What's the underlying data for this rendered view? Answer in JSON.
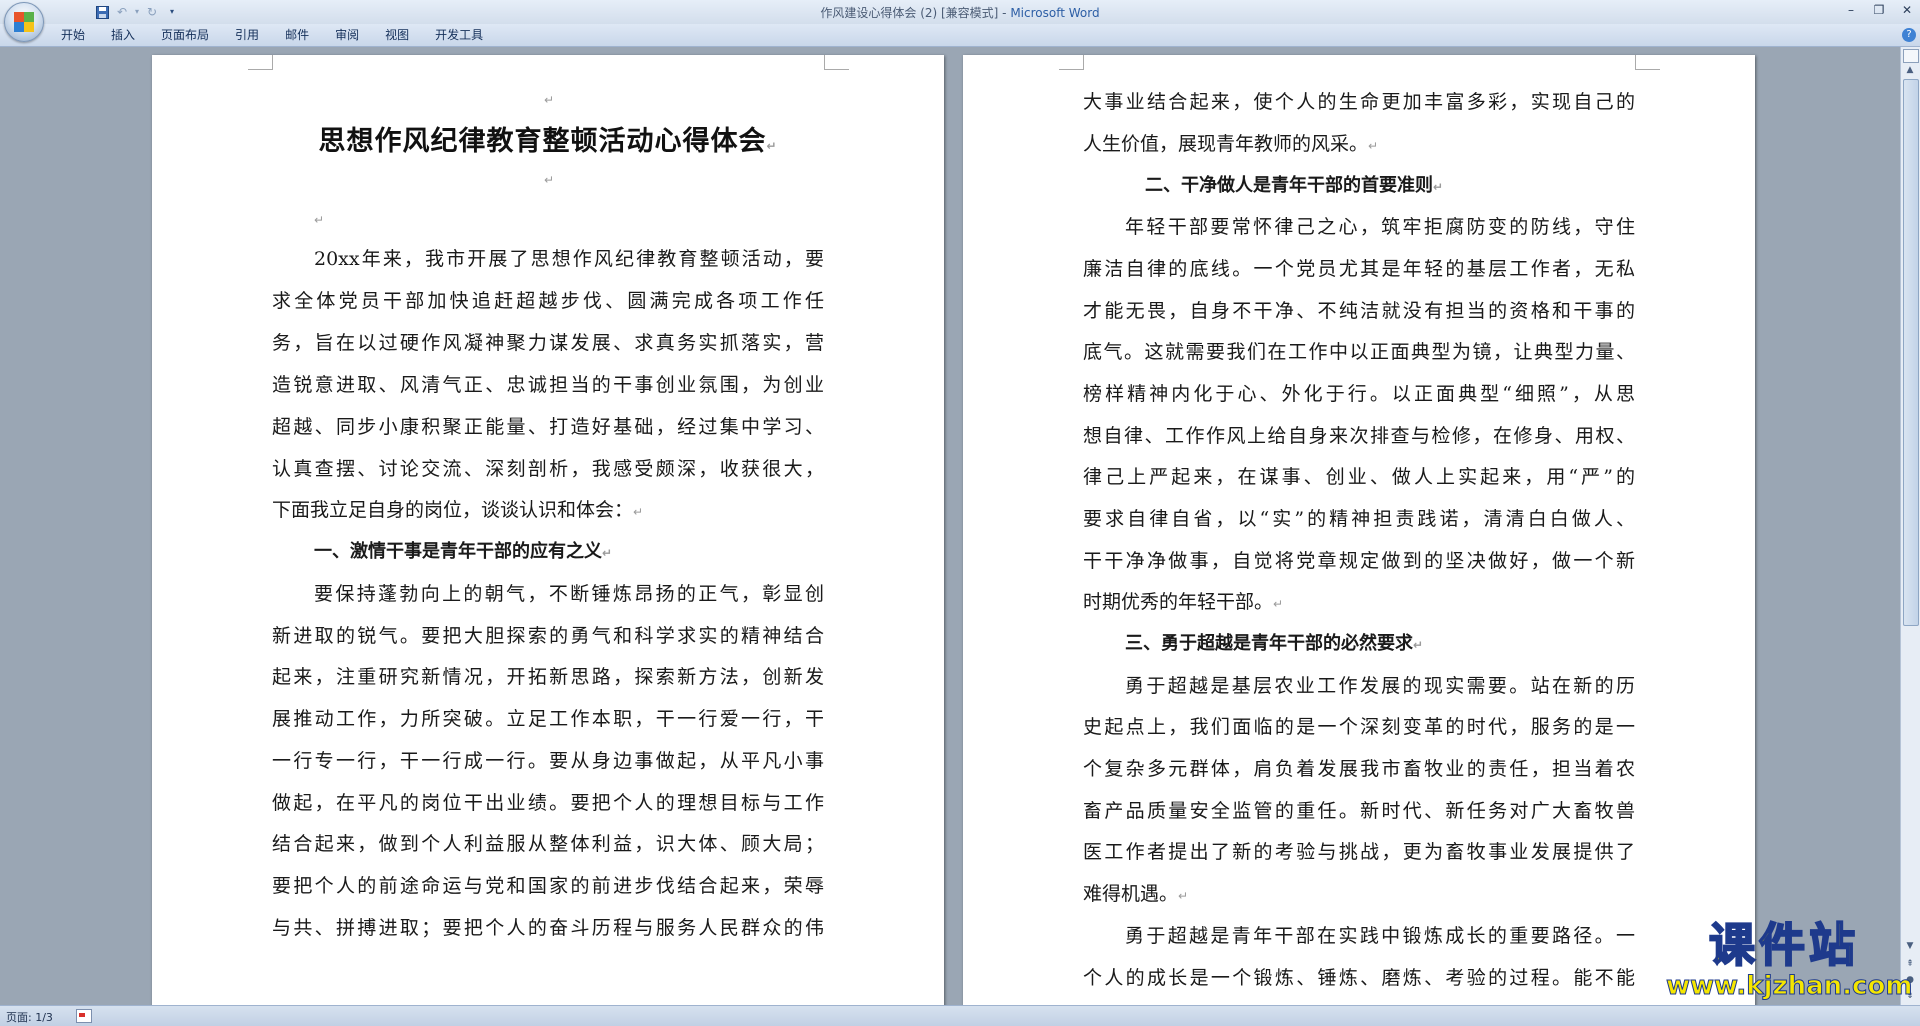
{
  "window": {
    "title_doc": "作风建设心得体会 (2) [兼容模式] - ",
    "title_app": "Microsoft Word"
  },
  "qat": {
    "save_icon": "save-icon",
    "undo_icon": "undo-icon",
    "redo_icon": "redo-icon",
    "customize_icon": "customize-icon"
  },
  "ribbon": {
    "tabs": [
      "开始",
      "插入",
      "页面布局",
      "引用",
      "邮件",
      "审阅",
      "视图",
      "开发工具"
    ]
  },
  "document": {
    "title": "思想作风纪律教育整顿活动心得体会",
    "left_lines": [
      "20xx年来，我市开展了思想作风纪律教育整顿活动，要",
      "求全体党员干部加快追赶超越步伐、圆满完成各项工作任",
      "务，旨在以过硬作风凝神聚力谋发展、求真务实抓落实，营",
      "造锐意进取、风清气正、忠诚担当的干事创业氛围，为创业",
      "超越、同步小康积聚正能量、打造好基础，经过集中学习、",
      "认真查摆、讨论交流、深刻剖析，我感受颇深，收获很大，",
      "下面我立足自身的岗位，谈谈认识和体会：",
      "一、激情干事是青年干部的应有之义",
      "要保持蓬勃向上的朝气，不断锤炼昂扬的正气，彰显创",
      "新进取的锐气。要把大胆探索的勇气和科学求实的精神结合",
      "起来，注重研究新情况，开拓新思路，探索新方法，创新发",
      "展推动工作，力所突破。立足工作本职，干一行爱一行，干",
      "一行专一行，干一行成一行。要从身边事做起，从平凡小事",
      "做起，在平凡的岗位干出业绩。要把个人的理想目标与工作",
      "结合起来，做到个人利益服从整体利益，识大体、顾大局；",
      "要把个人的前途命运与党和国家的前进步伐结合起来，荣辱",
      "与共、拼搏进取；要把个人的奋斗历程与服务人民群众的伟"
    ],
    "right_lines": [
      "大事业结合起来，使个人的生命更加丰富多彩，实现自己的",
      "人生价值，展现青年教师的风采。",
      "二、干净做人是青年干部的首要准则",
      "年轻干部要常怀律己之心，筑牢拒腐防变的防线，守住",
      "廉洁自律的底线。一个党员尤其是年轻的基层工作者，无私",
      "才能无畏，自身不干净、不纯洁就没有担当的资格和干事的",
      "底气。这就需要我们在工作中以正面典型为镜，让典型力量、",
      "榜样精神内化于心、外化于行。以正面典型“细照”，从思",
      "想自律、工作作风上给自身来次排查与检修，在修身、用权、",
      "律己上严起来，在谋事、创业、做人上实起来，用“严”的",
      "要求自律自省，以“实”的精神担责践诺，清清白白做人、",
      "干干净净做事，自觉将党章规定做到的坚决做好，做一个新",
      "时期优秀的年轻干部。",
      "三、勇于超越是青年干部的必然要求",
      "勇于超越是基层农业工作发展的现实需要。站在新的历",
      "史起点上，我们面临的是一个深刻变革的时代，服务的是一",
      "个复杂多元群体，肩负着发展我市畜牧业的责任，担当着农",
      "畜产品质量安全监管的重任。新时代、新任务对广大畜牧兽",
      "医工作者提出了新的考验与挑战，更为畜牧事业发展提供了",
      "难得机遇。",
      "勇于超越是青年干部在实践中锻炼成长的重要路径。一",
      "个人的成长是一个锻炼、锤炼、磨炼、考验的过程。能不能"
    ],
    "paragraph_mark": "↵"
  },
  "statusbar": {
    "page_label": "页面: 1/3"
  },
  "watermark": {
    "title": "课件站",
    "url": "www.kjzhan.com"
  }
}
